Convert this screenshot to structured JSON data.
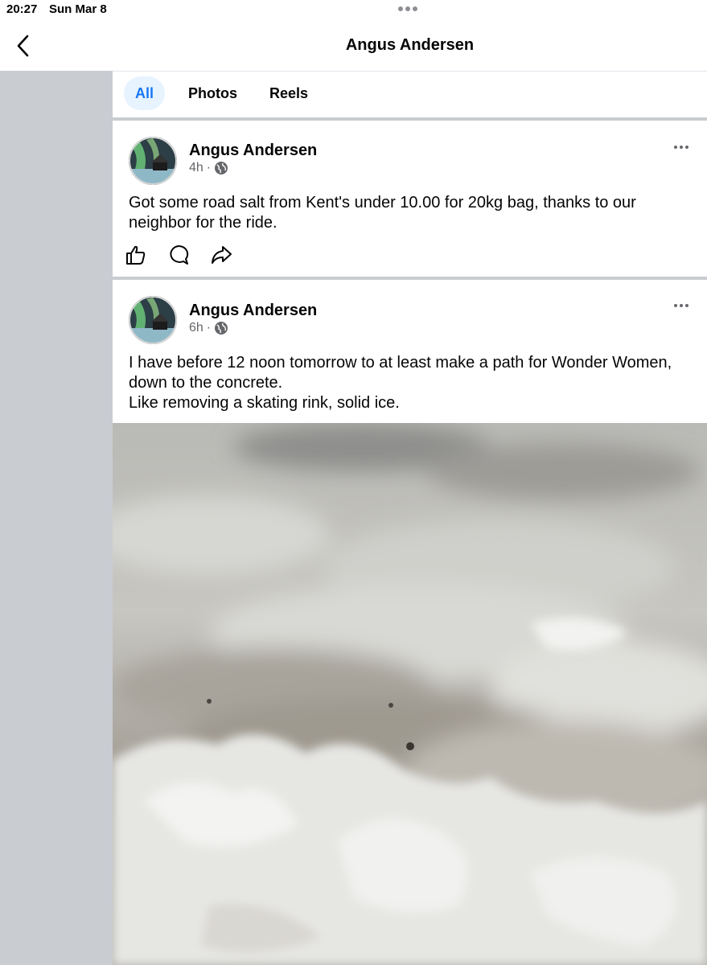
{
  "status_bar": {
    "time": "20:27",
    "date": "Sun Mar 8"
  },
  "nav": {
    "title": "Angus Andersen",
    "back_icon": "chevron-left-icon"
  },
  "tabs": [
    {
      "label": "All",
      "active": true
    },
    {
      "label": "Photos",
      "active": false
    },
    {
      "label": "Reels",
      "active": false
    }
  ],
  "posts": [
    {
      "author": "Angus Andersen",
      "time": "4h",
      "separator": "·",
      "audience_icon": "globe-icon",
      "text_lines": [
        "Got some road salt from Kent's under 10.00 for 20kg bag, thanks to our neighbor for the ride."
      ],
      "actions": [
        "like-icon",
        "comment-icon",
        "share-icon"
      ]
    },
    {
      "author": "Angus Andersen",
      "time": "6h",
      "separator": "·",
      "audience_icon": "globe-icon",
      "text_lines": [
        "I have before 12 noon tomorrow to at least make a path for Wonder Women, down to the concrete.",
        "Like removing a skating rink, solid ice."
      ],
      "photo": "ice-photo"
    }
  ],
  "colors": {
    "accent": "#1877f2",
    "tab_active_bg": "#e7f3ff",
    "feed_bg": "#c9ccd1",
    "secondary_text": "#65676b"
  }
}
